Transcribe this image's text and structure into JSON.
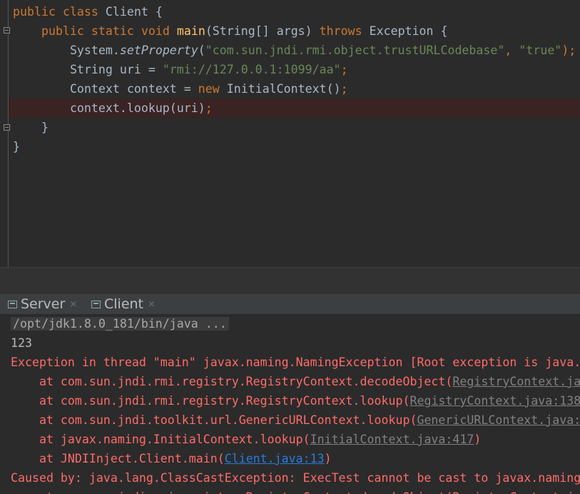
{
  "editor": {
    "line1": {
      "kw_public": "public",
      "kw_class": "class",
      "class_name": "Client",
      "brace": "{"
    },
    "line2": {
      "kw_public": "public",
      "kw_static": "static",
      "kw_void": "void",
      "method": "main",
      "params": "(String[] args)",
      "kw_throws": "throws",
      "exc": "Exception",
      "brace": "{"
    },
    "line3": {
      "recv": "System.",
      "call": "setProperty",
      "open": "(",
      "arg1": "\"com.sun.jndi.rmi.object.trustURLCodebase\"",
      "comma": ", ",
      "arg2": "\"true\"",
      "close": ");"
    },
    "line4": {
      "decl": "String uri = ",
      "value": "\"rmi://127.0.0.1:1099/aa\"",
      "semi": ";"
    },
    "line5": {
      "decl": "Context context = ",
      "kw_new": "new",
      "ctor": " InitialContext()",
      "semi": ";"
    },
    "line6": {
      "stmt": "context.lookup(uri)",
      "semi": ";"
    },
    "line7": {
      "brace": "}"
    },
    "line8": {
      "brace": "}"
    }
  },
  "tabs": [
    {
      "label": "Server",
      "close": "×",
      "icon": "console-icon"
    },
    {
      "label": "Client",
      "close": "×",
      "icon": "console-icon"
    }
  ],
  "console": {
    "command": "/opt/jdk1.8.0_181/bin/java ...",
    "output": "123",
    "exception_line": "Exception in thread \"main\" javax.naming.NamingException [Root exception is java.",
    "frames": [
      {
        "prefix": "    at com.sun.jndi.rmi.registry.RegistryContext.decodeObject(",
        "link": "RegistryContext.ja",
        "suffix": ""
      },
      {
        "prefix": "    at com.sun.jndi.rmi.registry.RegistryContext.lookup(",
        "link": "RegistryContext.java:138",
        "suffix": ""
      },
      {
        "prefix": "    at com.sun.jndi.toolkit.url.GenericURLContext.lookup(",
        "link": "GenericURLContext.java:",
        "suffix": ""
      },
      {
        "prefix": "    at javax.naming.InitialContext.lookup(",
        "link": "InitialContext.java:417",
        "suffix": ")"
      },
      {
        "prefix": "    at JNDIInject.Client.main(",
        "link": "Client.java:13",
        "suffix": ")"
      }
    ],
    "caused_by": "Caused by: java.lang.ClassCastException: ExecTest cannot be cast to javax.naming",
    "partial_line": "    at com.sun.jndi.rmi.registry.RegistryContext.decodeObject(RegistryContext.java"
  },
  "colors": {
    "keyword": "#cc7832",
    "method": "#ffc66d",
    "string": "#6a8759",
    "error": "#ff6b68",
    "link": "#287bde"
  }
}
